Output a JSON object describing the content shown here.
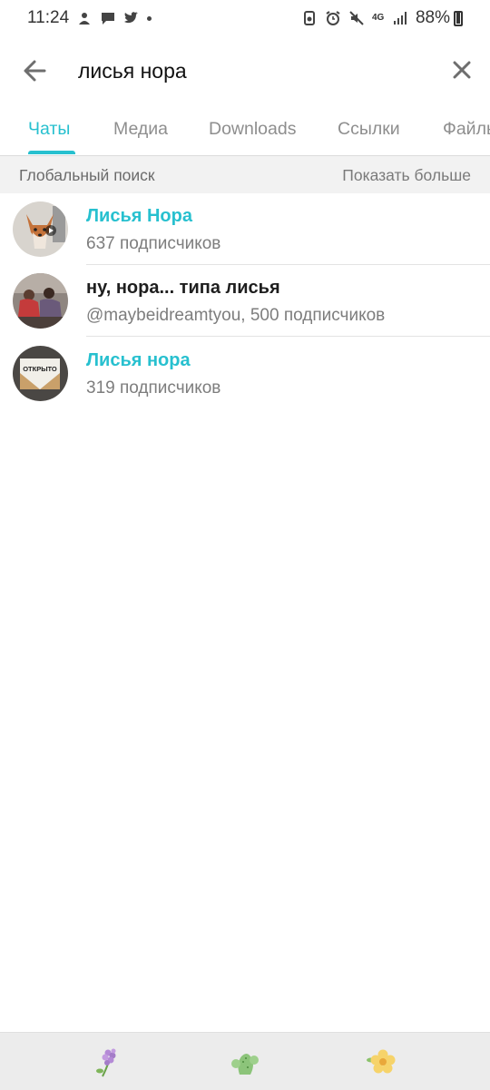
{
  "status_bar": {
    "time": "11:24",
    "network": "4G",
    "battery": "88%"
  },
  "search": {
    "query": "лисья нора",
    "back_icon": "arrow-left-icon",
    "clear_icon": "close-icon"
  },
  "tabs": [
    {
      "label": "Чаты",
      "active": true
    },
    {
      "label": "Медиа",
      "active": false
    },
    {
      "label": "Downloads",
      "active": false
    },
    {
      "label": "Ссылки",
      "active": false
    },
    {
      "label": "Файлы",
      "active": false
    }
  ],
  "section": {
    "title": "Глобальный поиск",
    "more": "Показать больше"
  },
  "results": [
    {
      "title": "Лисья Нора",
      "subtitle": "637 подписчиков",
      "avatar": "fox-photo"
    },
    {
      "title": "ну, нора... типа лисья",
      "subtitle": "@maybeidreamtyou, 500 подписчиков",
      "avatar": "people-photo"
    },
    {
      "title": "Лисья нора",
      "subtitle": "319 подписчиков",
      "avatar": "open-sign-photo"
    }
  ],
  "colors": {
    "accent": "#27c0cf",
    "nav_background": "#ececec"
  },
  "nav_icons": [
    "lilac-flower-icon",
    "cactus-icon",
    "yellow-flower-icon"
  ]
}
